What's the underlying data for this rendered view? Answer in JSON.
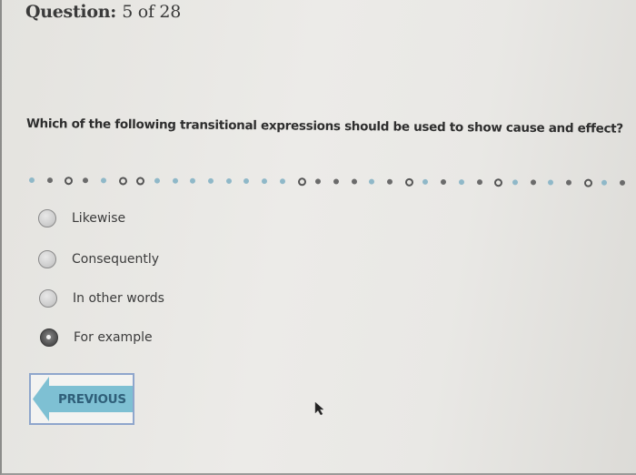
{
  "header": {
    "label": "Question:",
    "current": 5,
    "total": 28,
    "progress_text": "5 of 28"
  },
  "question": {
    "text": "Which of the following transitional expressions should be used to show cause and effect?"
  },
  "progress_dots": [
    "unanswered",
    "answered",
    "marked",
    "answered",
    "unanswered",
    "marked",
    "marked",
    "unanswered",
    "unanswered",
    "unanswered",
    "unanswered",
    "unanswered",
    "unanswered",
    "unanswered",
    "unanswered",
    "marked",
    "answered",
    "answered",
    "answered",
    "unanswered",
    "answered",
    "marked",
    "unanswered",
    "answered",
    "unanswered",
    "answered",
    "marked",
    "unanswered",
    "answered",
    "unanswered",
    "answered",
    "marked",
    "unanswered",
    "answered",
    "unanswered"
  ],
  "colors": {
    "dot_answered": "#6b6b6b",
    "dot_unanswered": "#8fb8c8",
    "prev_button_fill": "#7ec0d3",
    "prev_button_text": "#2f5f79",
    "prev_button_border": "#8fa6cc"
  },
  "options": [
    {
      "label": "Likewise",
      "selected": false
    },
    {
      "label": "Consequently",
      "selected": false
    },
    {
      "label": "In other words",
      "selected": false
    },
    {
      "label": "For example",
      "selected": true
    }
  ],
  "navigation": {
    "previous_label": "PREVIOUS",
    "previous_icon": "left-arrow-icon"
  }
}
